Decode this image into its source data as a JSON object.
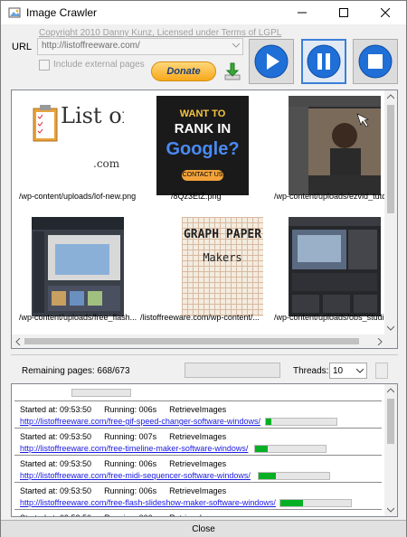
{
  "window": {
    "title": "Image Crawler"
  },
  "header": {
    "copyright": "Copyright 2010 Danny Kunz, Licensed under Terms of LGPL",
    "url_label": "URL",
    "url_value": "http://listoffreeware.com/",
    "include_external_label": "Include external pages",
    "include_external_checked": false,
    "donate_label": "Donate"
  },
  "gallery": {
    "items": [
      {
        "caption": "/wp-content/uploads/lof-new.png",
        "thumb_title": "List of Freeware",
        "thumb_sub": ".com",
        "icon": "lof-logo"
      },
      {
        "caption": "/8Qz3EtZ.png",
        "thumb_l1": "WANT TO",
        "thumb_l2": "RANK IN",
        "thumb_l3": "Google?",
        "thumb_l4": "CONTACT US",
        "icon": "google-rank-ad"
      },
      {
        "caption": "/wp-content/uploads/ezvid_tutor",
        "icon": "webcam-screenshot"
      },
      {
        "caption": "/wp-content/uploads/free_flash...",
        "icon": "flash-app-screenshot"
      },
      {
        "caption": "/listoffreeware.com/wp-content/...",
        "thumb_title": "GRAPH PAPER",
        "thumb_sub": "Makers",
        "icon": "graph-paper-image"
      },
      {
        "caption": "/wp-content/uploads/obs_studio",
        "icon": "obs-screenshot"
      }
    ]
  },
  "status": {
    "remaining": "Remaining pages: 668/673",
    "threads_label": "Threads:",
    "threads_value": "10"
  },
  "tasks": [
    {
      "started": "Started at: 09:53:50",
      "running": "Running: 006s",
      "action": "RetrieveImages",
      "url": "http://listoffreeware.com/free-gif-speed-changer-software-windows/",
      "progress": 0.08
    },
    {
      "started": "Started at: 09:53:50",
      "running": "Running: 007s",
      "action": "RetrieveImages",
      "url": "http://listoffreeware.com/free-timeline-maker-software-windows/",
      "progress": 0.18
    },
    {
      "started": "Started at: 09:53:50",
      "running": "Running: 006s",
      "action": "RetrieveImages",
      "url": "http://listoffreeware.com/free-midi-sequencer-software-windows/",
      "progress": 0.24
    },
    {
      "started": "Started at: 09:53:50",
      "running": "Running: 006s",
      "action": "RetrieveImages",
      "url": "http://listoffreeware.com/free-flash-slideshow-maker-software-windows/",
      "progress": 0.32
    },
    {
      "started": "Started at: 09:53:50",
      "running": "Running: 006s",
      "action": "RetrieveImages",
      "url": "",
      "progress": 0
    }
  ],
  "footer": {
    "close_label": "Close"
  },
  "colors": {
    "accent": "#3c7fd8",
    "progress": "#06b025",
    "link": "#1a1ae0"
  }
}
